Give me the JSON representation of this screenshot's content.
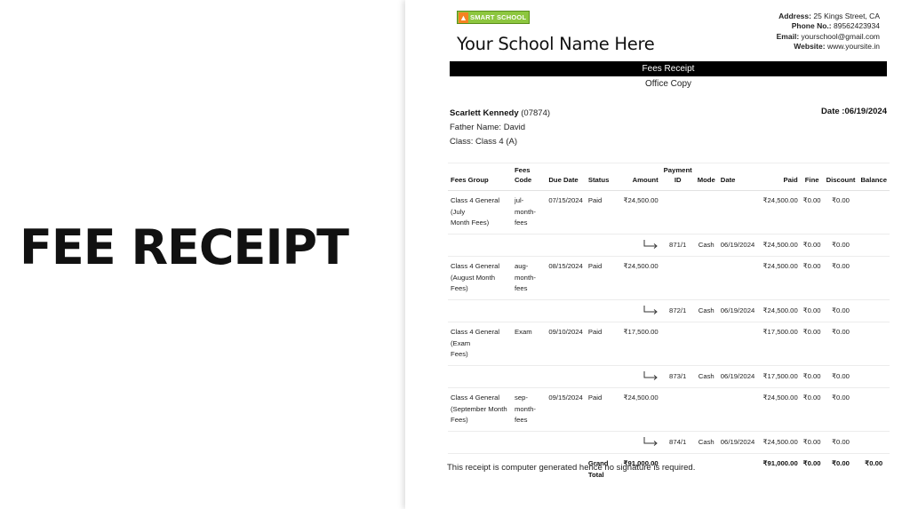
{
  "left_label": "FEE RECEIPT",
  "logo_text": "SMART SCHOOL",
  "school_name": "Your School Name Here",
  "contact": {
    "address_label": "Address:",
    "address": "25 Kings Street, CA",
    "phone_label": "Phone No.:",
    "phone": "89562423934",
    "email_label": "Email:",
    "email": "yourschool@gmail.com",
    "website_label": "Website:",
    "website": "www.yoursite.in"
  },
  "receipt_title": "Fees Receipt",
  "copy_label": "Office Copy",
  "student": {
    "name": "Scarlett Kennedy",
    "admission_no": "(07874)",
    "father": "Father Name: David",
    "class": "Class: Class 4 (A)"
  },
  "date": "Date :06/19/2024",
  "columns": {
    "fees_group": "Fees Group",
    "fees_code": "Fees Code",
    "due_date": "Due Date",
    "status": "Status",
    "amount": "Amount",
    "payment_id_1": "Payment",
    "payment_id_2": "ID",
    "mode": "Mode",
    "date": "Date",
    "paid": "Paid",
    "fine": "Fine",
    "discount": "Discount",
    "balance": "Balance"
  },
  "rows": [
    {
      "group_1": "Class 4 General (July",
      "group_2": "Month Fees)",
      "code_1": "jul-month-",
      "code_2": "fees",
      "code_3": "",
      "due": "07/15/2024",
      "status": "Paid",
      "amount": "₹24,500.00",
      "paid": "₹24,500.00",
      "fine": "₹0.00",
      "discount": "₹0.00",
      "payment": {
        "id": "871/1",
        "mode": "Cash",
        "date": "06/19/2024",
        "paid": "₹24,500.00",
        "fine": "₹0.00",
        "discount": "₹0.00"
      }
    },
    {
      "group_1": "Class 4 General",
      "group_2": "(August Month Fees)",
      "code_1": "aug-",
      "code_2": "month-",
      "code_3": "fees",
      "due": "08/15/2024",
      "status": "Paid",
      "amount": "₹24,500.00",
      "paid": "₹24,500.00",
      "fine": "₹0.00",
      "discount": "₹0.00",
      "payment": {
        "id": "872/1",
        "mode": "Cash",
        "date": "06/19/2024",
        "paid": "₹24,500.00",
        "fine": "₹0.00",
        "discount": "₹0.00"
      }
    },
    {
      "group_1": "Class 4 General (Exam",
      "group_2": "Fees)",
      "code_1": "Exam",
      "code_2": "",
      "code_3": "",
      "due": "09/10/2024",
      "status": "Paid",
      "amount": "₹17,500.00",
      "paid": "₹17,500.00",
      "fine": "₹0.00",
      "discount": "₹0.00",
      "payment": {
        "id": "873/1",
        "mode": "Cash",
        "date": "06/19/2024",
        "paid": "₹17,500.00",
        "fine": "₹0.00",
        "discount": "₹0.00"
      }
    },
    {
      "group_1": "Class 4 General",
      "group_2": "(September Month",
      "group_3": "Fees)",
      "code_1": "sep-",
      "code_2": "month-",
      "code_3": "fees",
      "due": "09/15/2024",
      "status": "Paid",
      "amount": "₹24,500.00",
      "paid": "₹24,500.00",
      "fine": "₹0.00",
      "discount": "₹0.00",
      "payment": {
        "id": "874/1",
        "mode": "Cash",
        "date": "06/19/2024",
        "paid": "₹24,500.00",
        "fine": "₹0.00",
        "discount": "₹0.00"
      }
    }
  ],
  "total": {
    "label_1": "Grand",
    "label_2": "Total",
    "amount": "₹91,000.00",
    "paid": "₹91,000.00",
    "fine": "₹0.00",
    "discount": "₹0.00",
    "balance": "₹0.00"
  },
  "footer": "This receipt is computer generated hence no signature is required."
}
